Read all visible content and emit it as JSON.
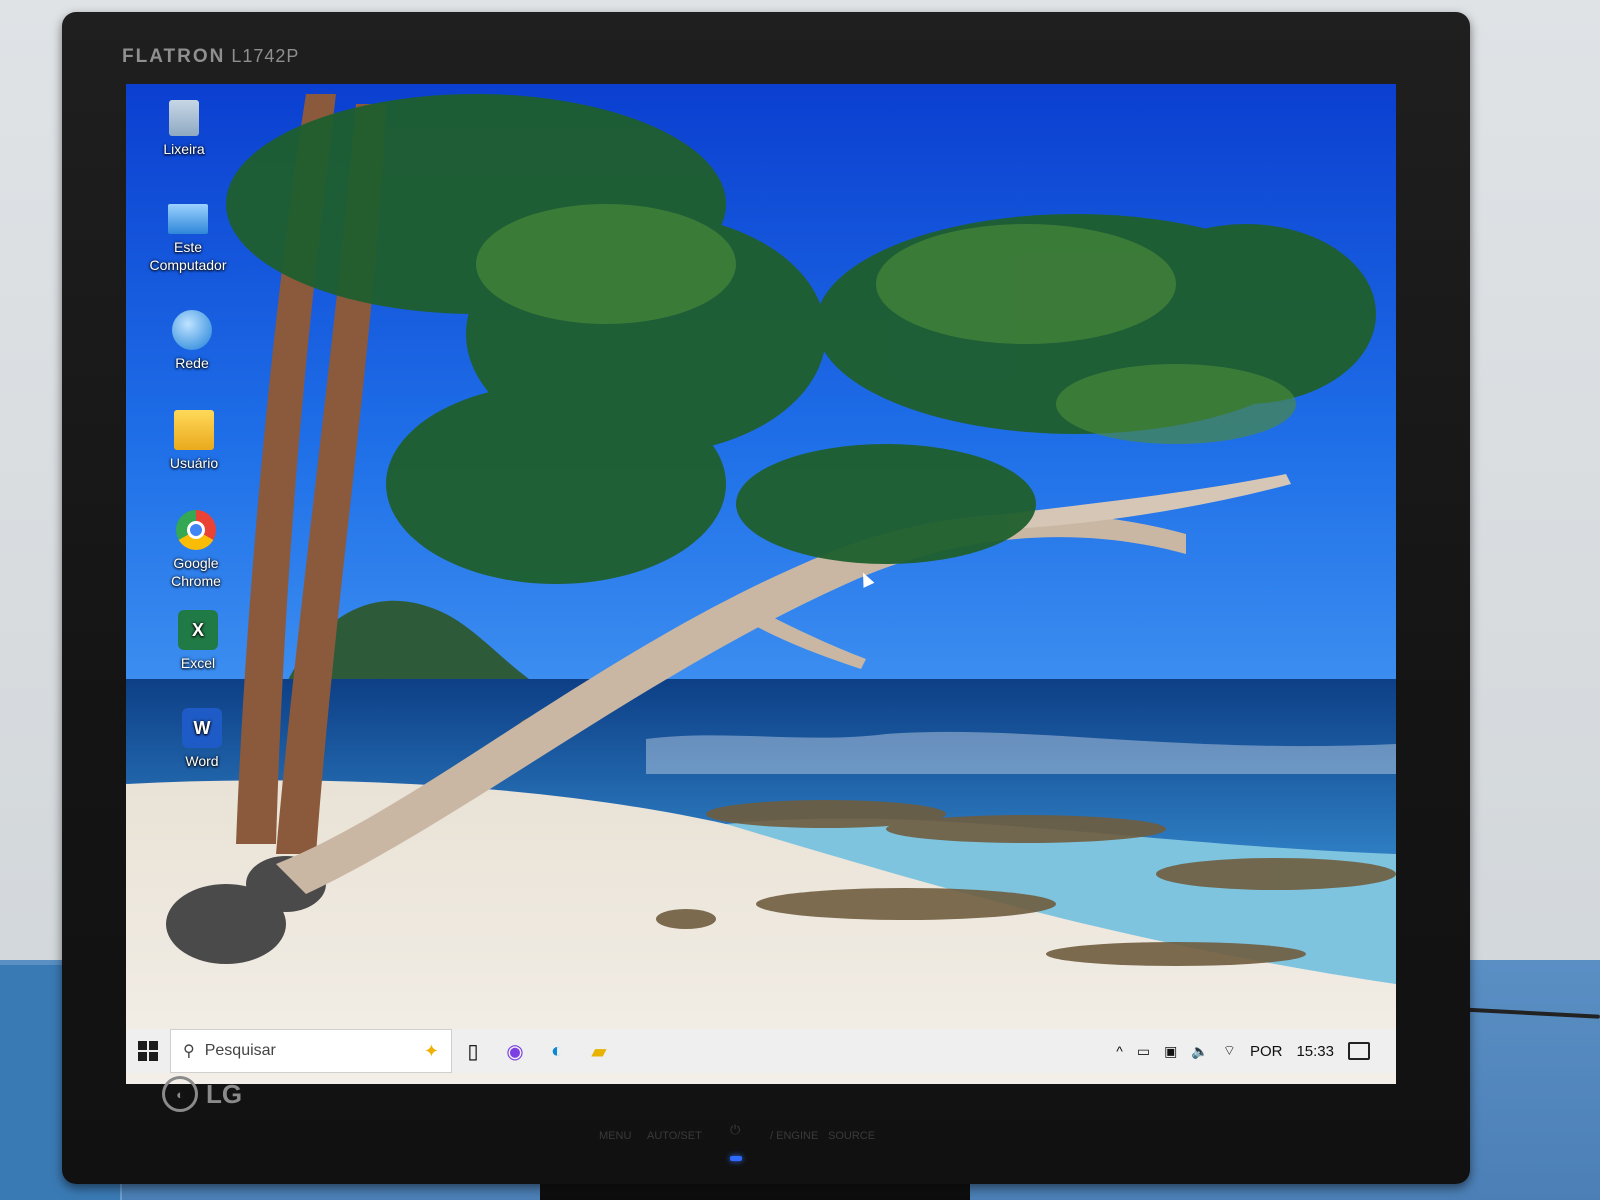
{
  "monitor": {
    "brand": "FLATRON",
    "model": "L1742P",
    "logo": "LG",
    "controls": [
      "MENU",
      "AUTO/SET",
      "/ ENGINE",
      "SOURCE"
    ]
  },
  "desktop": {
    "icons": [
      {
        "label": "Lixeira",
        "icon": "recycle-bin-icon"
      },
      {
        "label": "Este Computador",
        "icon": "computer-icon"
      },
      {
        "label": "Rede",
        "icon": "network-icon"
      },
      {
        "label": "Usuário",
        "icon": "user-folder-icon"
      },
      {
        "label": "Google Chrome",
        "icon": "chrome-icon"
      },
      {
        "label": "Excel",
        "icon": "excel-icon"
      },
      {
        "label": "Word",
        "icon": "word-icon"
      }
    ]
  },
  "taskbar": {
    "search_placeholder": "Pesquisar",
    "pinned": [
      "task-view-icon",
      "copilot-icon",
      "edge-icon",
      "file-explorer-icon"
    ],
    "tray": {
      "language": "POR",
      "time": "15:33"
    }
  },
  "colors": {
    "sky": "#1a4fd1",
    "sea": "#1d5fb0",
    "taskbar": "#efefef"
  }
}
